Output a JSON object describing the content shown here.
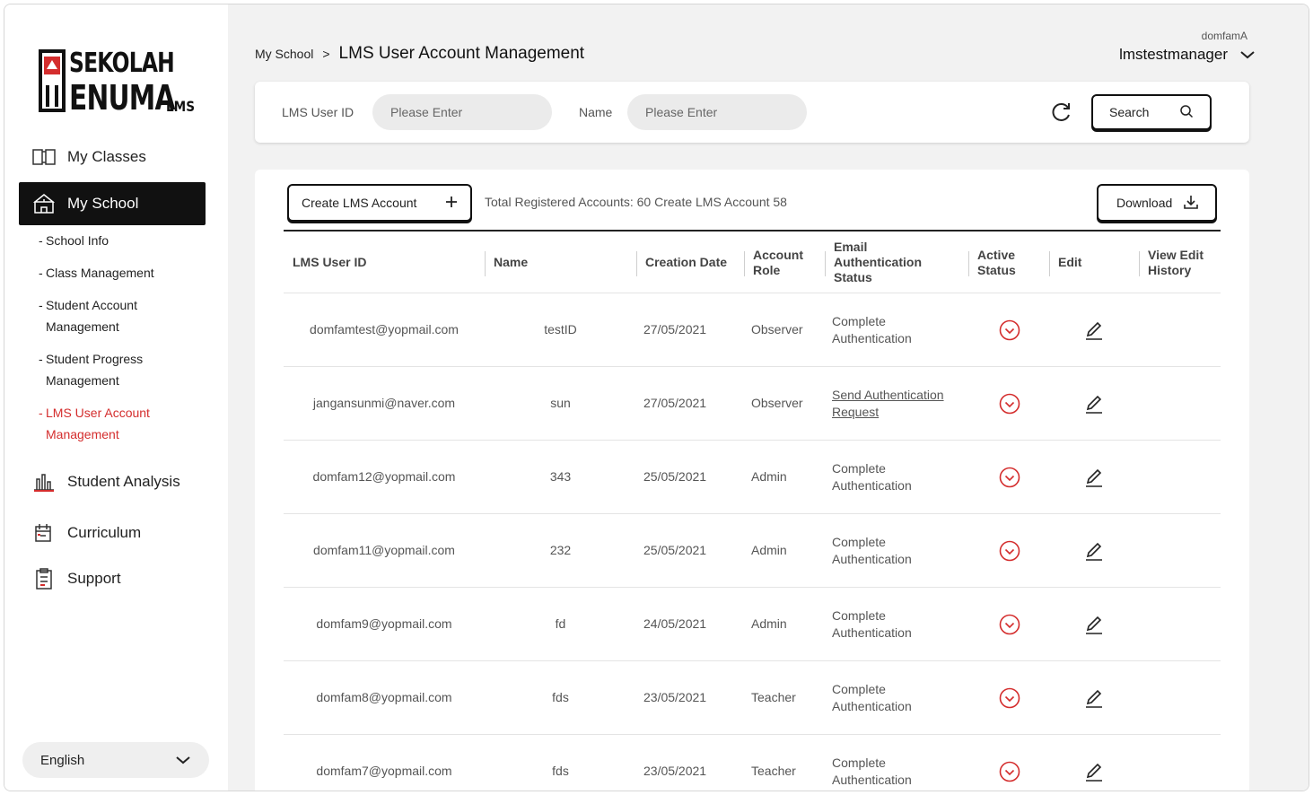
{
  "logo": {
    "line1": "SEKOLAH",
    "line2": "ENUMA",
    "suffix": "LMS"
  },
  "sidebar": {
    "items": [
      {
        "label": "My Classes",
        "icon": "book-icon"
      },
      {
        "label": "My School",
        "icon": "school-icon",
        "active": true
      },
      {
        "label": "Student Analysis",
        "icon": "bar-chart-icon"
      },
      {
        "label": "Curriculum",
        "icon": "curriculum-icon"
      },
      {
        "label": "Support",
        "icon": "clipboard-icon"
      }
    ],
    "sub_items": [
      {
        "label": "School Info"
      },
      {
        "label": "Class Management"
      },
      {
        "label": "Student Account Management"
      },
      {
        "label": "Student Progress Management"
      },
      {
        "label": "LMS User Account Management",
        "active": true
      }
    ],
    "language": "English"
  },
  "header": {
    "breadcrumb_root": "My School",
    "breadcrumb_sep": ">",
    "page_title": "LMS User Account Management",
    "user_small": "domfamA",
    "user_name": "lmstestmanager"
  },
  "search": {
    "user_id_label": "LMS User ID",
    "user_id_placeholder": "Please Enter",
    "name_label": "Name",
    "name_placeholder": "Please Enter",
    "search_label": "Search"
  },
  "toolbar": {
    "create_label": "Create LMS Account",
    "total_text": "Total Registered Accounts: 60 Create LMS Account 58",
    "download_label": "Download"
  },
  "table": {
    "headers": [
      "LMS User ID",
      "Name",
      "Creation Date",
      "Account Role",
      "Email Authentication Status",
      "Active Status",
      "Edit",
      "View Edit History"
    ],
    "rows": [
      {
        "id": "domfamtest@yopmail.com",
        "name": "testID",
        "date": "27/05/2021",
        "role": "Observer",
        "auth": "Complete Authentication",
        "auth_link": false
      },
      {
        "id": "jangansunmi@naver.com",
        "name": "sun",
        "date": "27/05/2021",
        "role": "Observer",
        "auth": "Send Authentication Request",
        "auth_link": true
      },
      {
        "id": "domfam12@yopmail.com",
        "name": "343",
        "date": "25/05/2021",
        "role": "Admin",
        "auth": "Complete Authentication",
        "auth_link": false
      },
      {
        "id": "domfam11@yopmail.com",
        "name": "232",
        "date": "25/05/2021",
        "role": "Admin",
        "auth": "Complete Authentication",
        "auth_link": false
      },
      {
        "id": "domfam9@yopmail.com",
        "name": "fd",
        "date": "24/05/2021",
        "role": "Admin",
        "auth": "Complete Authentication",
        "auth_link": false
      },
      {
        "id": "domfam8@yopmail.com",
        "name": "fds",
        "date": "23/05/2021",
        "role": "Teacher",
        "auth": "Complete Authentication",
        "auth_link": false
      },
      {
        "id": "domfam7@yopmail.com",
        "name": "fds",
        "date": "23/05/2021",
        "role": "Teacher",
        "auth": "Complete Authentication",
        "auth_link": false
      }
    ]
  },
  "colors": {
    "accent": "#d42d2d",
    "dark": "#111111",
    "background": "#f2f2f2"
  }
}
